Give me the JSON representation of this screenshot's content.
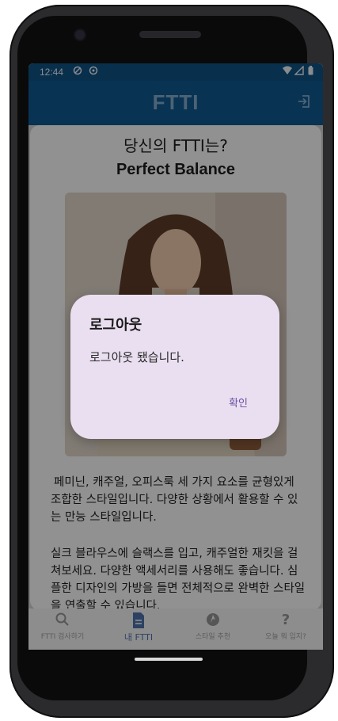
{
  "status_bar": {
    "time": "12:44"
  },
  "app_bar": {
    "title": "FTTI"
  },
  "result": {
    "question": "당신의 FTTI는?",
    "type_name": "Perfect Balance",
    "description": "페미닌, 캐주얼, 오피스룩 세 가지 요소를 균형있게 조합한 스타일입니다. 다양한 상황에서 활용할 수 있는 만능 스타일입니다.",
    "recommendation": "실크 블라우스에 슬랙스를 입고, 캐주얼한 재킷을 걸쳐보세요. 다양한 액세서리를 사용해도 좋습니다. 심플한 디자인의 가방을 들면 전체적으로 완벽한 스타일을 연출할 수 있습니다."
  },
  "bottom_nav": {
    "items": [
      {
        "label": "FTTI 검사하기",
        "icon": "search-icon"
      },
      {
        "label": "내 FTTI",
        "icon": "document-icon",
        "active": true
      },
      {
        "label": "스타일 추천",
        "icon": "style-icon"
      },
      {
        "label": "오늘 뭐 입지?",
        "icon": "question-icon"
      }
    ]
  },
  "dialog": {
    "title": "로그아웃",
    "message": "로그아웃 됐습니다.",
    "confirm": "확인"
  },
  "colors": {
    "app_bar": "#10568a",
    "status_bar": "#0e4f7f",
    "dialog_bg": "#eadff0",
    "dialog_button": "#6b4fa6",
    "nav_active": "#4b6fa6"
  }
}
